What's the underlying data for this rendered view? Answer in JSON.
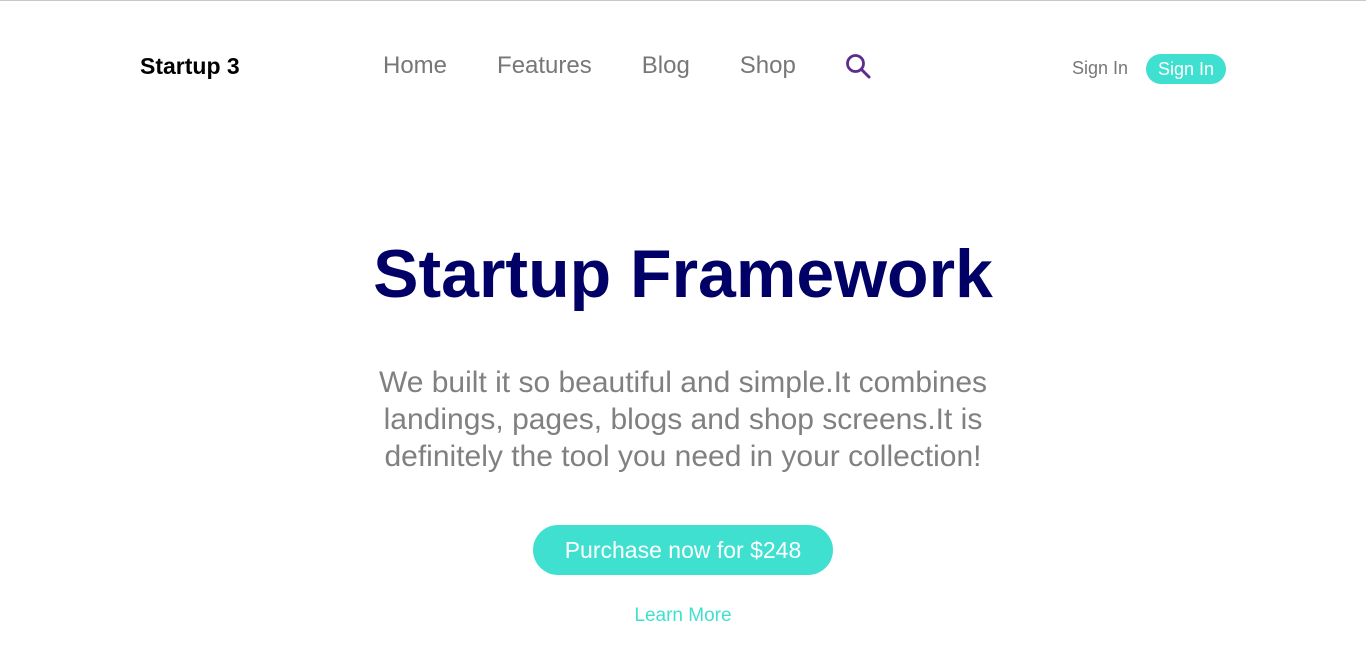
{
  "colors": {
    "accent": "#40e0d0",
    "title": "#000066",
    "muted_text": "#808080",
    "nav_text": "#777777",
    "search_icon": "#5b2d8e"
  },
  "navbar": {
    "brand": "Startup 3",
    "links": [
      "Home",
      "Features",
      "Blog",
      "Shop"
    ],
    "search_icon": "search-icon",
    "signin_link": "Sign In",
    "signin_button": "Sign In"
  },
  "hero": {
    "title": "Startup Framework",
    "text": "We built it so beautiful and simple.It combines landings, pages, blogs and shop screens.It is definitely the tool you need in your collection!",
    "purchase_button": "Purchase now for $248",
    "learn_more": "Learn More"
  }
}
